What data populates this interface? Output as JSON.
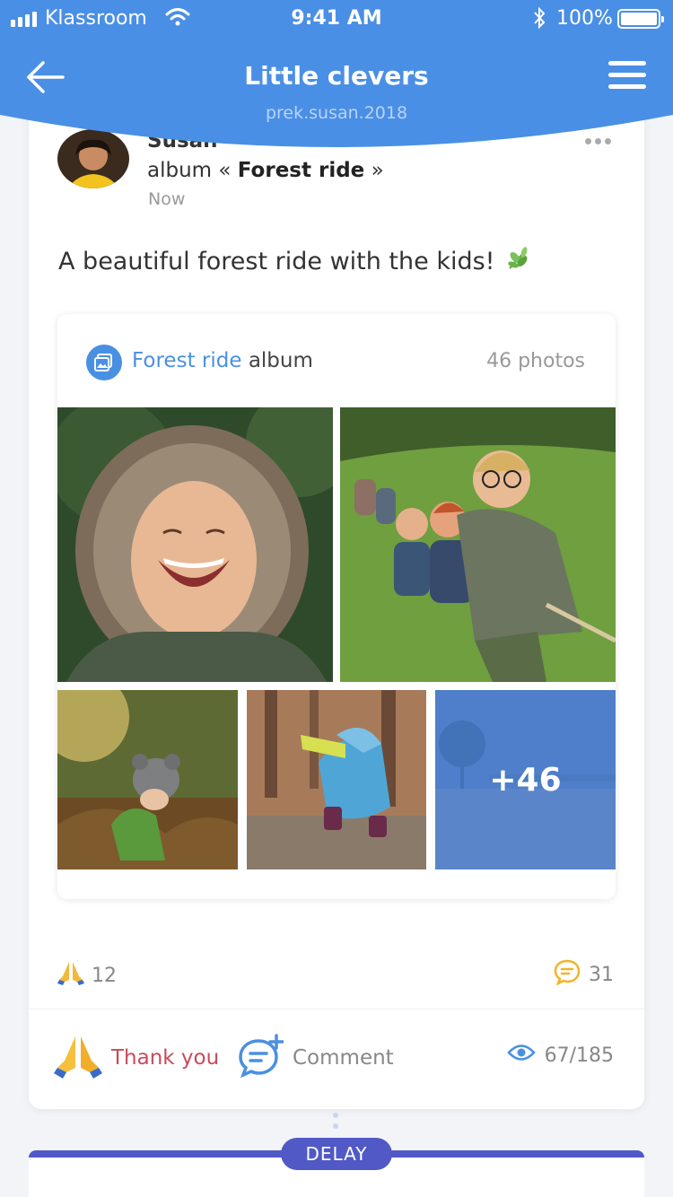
{
  "status_bar": {
    "carrier": "Klassroom",
    "time": "9:41 AM",
    "battery": "100%"
  },
  "header": {
    "title": "Little clevers",
    "subtitle": "prek.susan.2018",
    "back_icon": "arrow-left-icon",
    "menu_icon": "hamburger-menu-icon"
  },
  "post": {
    "author_partial": "Susan",
    "album_prefix": "album «",
    "album_title": "Forest ride",
    "album_suffix": "»",
    "time": "Now",
    "text": "A beautiful forest ride with the kids!",
    "text_icon": "leaf-icon"
  },
  "album": {
    "link_label": "Forest ride",
    "label_suffix": "album",
    "count_label": "46 photos",
    "more_label": "+46"
  },
  "stats": {
    "reactions": "12",
    "comments": "31",
    "views": "67/185"
  },
  "actions": {
    "thank_label": "Thank you",
    "comment_label": "Comment"
  },
  "next_card": {
    "badge": "DELAY"
  },
  "colors": {
    "header_blue": "#4a8fe6",
    "accent_blue": "#4a90e2",
    "thank_red": "#c94a5a",
    "delay_purple": "#5159c6",
    "comment_yellow": "#f0b429"
  }
}
